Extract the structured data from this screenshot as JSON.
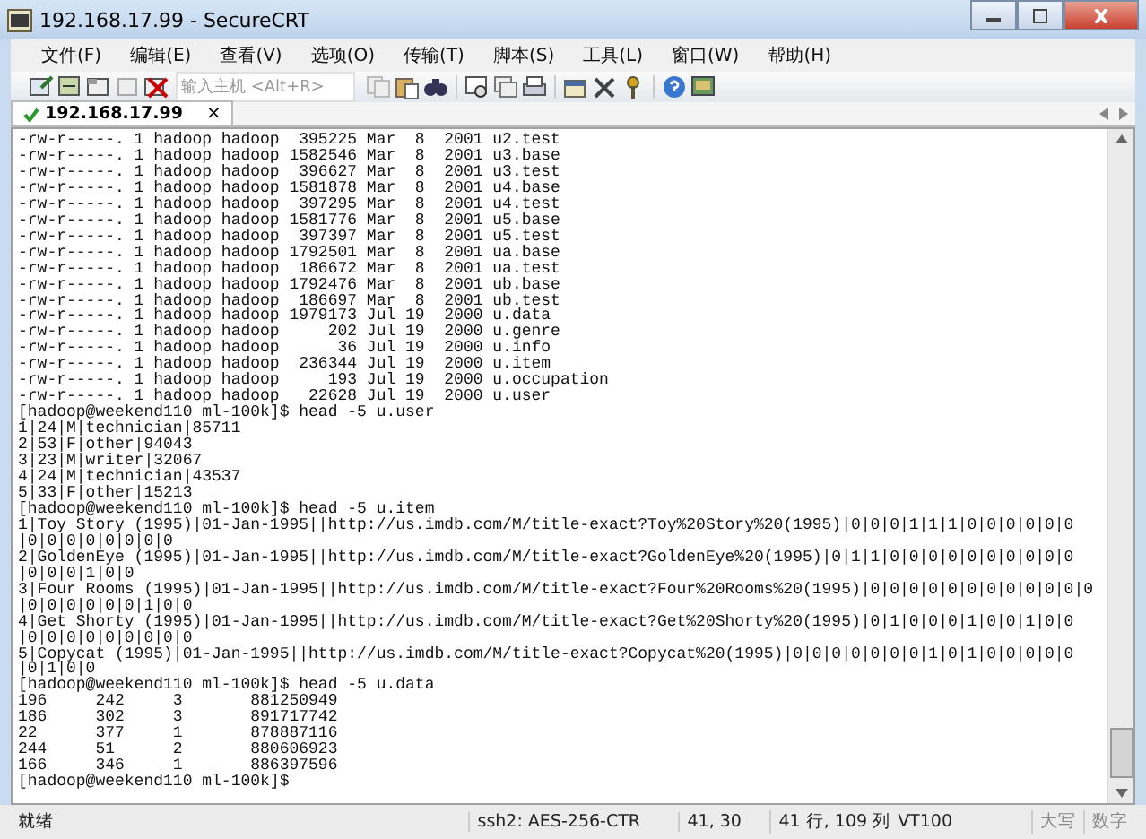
{
  "window": {
    "title": "192.168.17.99 - SecureCRT"
  },
  "menu": [
    "文件(F)",
    "编辑(E)",
    "查看(V)",
    "选项(O)",
    "传输(T)",
    "脚本(S)",
    "工具(L)",
    "窗口(W)",
    "帮助(H)"
  ],
  "toolbar": {
    "host_field": {
      "placeholder": "输入主机 <Alt+R>"
    }
  },
  "tabs": [
    {
      "label": "192.168.17.99",
      "close": "×",
      "connected": true,
      "selected": true
    }
  ],
  "terminal": {
    "lines": [
      "-rw-r-----. 1 hadoop hadoop  395225 Mar  8  2001 u2.test",
      "-rw-r-----. 1 hadoop hadoop 1582546 Mar  8  2001 u3.base",
      "-rw-r-----. 1 hadoop hadoop  396627 Mar  8  2001 u3.test",
      "-rw-r-----. 1 hadoop hadoop 1581878 Mar  8  2001 u4.base",
      "-rw-r-----. 1 hadoop hadoop  397295 Mar  8  2001 u4.test",
      "-rw-r-----. 1 hadoop hadoop 1581776 Mar  8  2001 u5.base",
      "-rw-r-----. 1 hadoop hadoop  397397 Mar  8  2001 u5.test",
      "-rw-r-----. 1 hadoop hadoop 1792501 Mar  8  2001 ua.base",
      "-rw-r-----. 1 hadoop hadoop  186672 Mar  8  2001 ua.test",
      "-rw-r-----. 1 hadoop hadoop 1792476 Mar  8  2001 ub.base",
      "-rw-r-----. 1 hadoop hadoop  186697 Mar  8  2001 ub.test",
      "-rw-r-----. 1 hadoop hadoop 1979173 Jul 19  2000 u.data",
      "-rw-r-----. 1 hadoop hadoop     202 Jul 19  2000 u.genre",
      "-rw-r-----. 1 hadoop hadoop      36 Jul 19  2000 u.info",
      "-rw-r-----. 1 hadoop hadoop  236344 Jul 19  2000 u.item",
      "-rw-r-----. 1 hadoop hadoop     193 Jul 19  2000 u.occupation",
      "-rw-r-----. 1 hadoop hadoop   22628 Jul 19  2000 u.user",
      "[hadoop@weekend110 ml-100k]$ head -5 u.user",
      "1|24|M|technician|85711",
      "2|53|F|other|94043",
      "3|23|M|writer|32067",
      "4|24|M|technician|43537",
      "5|33|F|other|15213",
      "[hadoop@weekend110 ml-100k]$ head -5 u.item",
      "1|Toy Story (1995)|01-Jan-1995||http://us.imdb.com/M/title-exact?Toy%20Story%20(1995)|0|0|0|1|1|1|0|0|0|0|0|0",
      "|0|0|0|0|0|0|0|0",
      "2|GoldenEye (1995)|01-Jan-1995||http://us.imdb.com/M/title-exact?GoldenEye%20(1995)|0|1|1|0|0|0|0|0|0|0|0|0|0",
      "|0|0|0|1|0|0",
      "3|Four Rooms (1995)|01-Jan-1995||http://us.imdb.com/M/title-exact?Four%20Rooms%20(1995)|0|0|0|0|0|0|0|0|0|0|0|0",
      "|0|0|0|0|0|0|1|0|0",
      "4|Get Shorty (1995)|01-Jan-1995||http://us.imdb.com/M/title-exact?Get%20Shorty%20(1995)|0|1|0|0|0|1|0|0|1|0|0",
      "|0|0|0|0|0|0|0|0|0",
      "5|Copycat (1995)|01-Jan-1995||http://us.imdb.com/M/title-exact?Copycat%20(1995)|0|0|0|0|0|0|0|1|0|1|0|0|0|0|0",
      "|0|1|0|0",
      "[hadoop@weekend110 ml-100k]$ head -5 u.data",
      "196     242     3       881250949",
      "186     302     3       891717742",
      "22      377     1       878887116",
      "244     51      2       880606923",
      "166     346     1       886397596",
      "[hadoop@weekend110 ml-100k]$"
    ]
  },
  "status_bar": {
    "ready": "就绪",
    "cipher": "ssh2: AES-256-CTR",
    "position": "41, 30",
    "size": "41 行, 109 列",
    "emulation": "VT100",
    "indicators": [
      {
        "label": "大写",
        "on": false
      },
      {
        "label": "数字",
        "on": false
      }
    ]
  }
}
